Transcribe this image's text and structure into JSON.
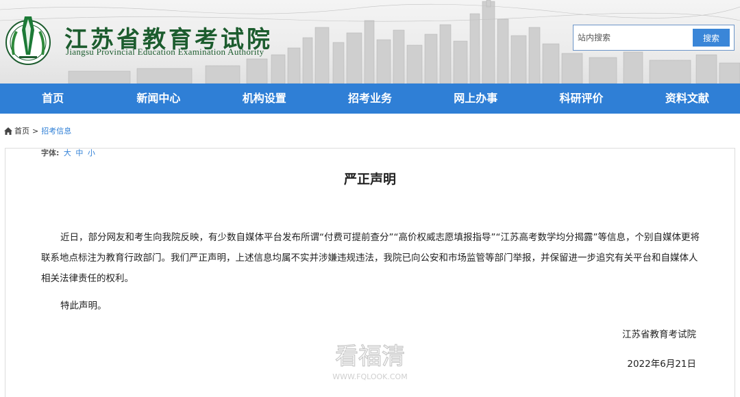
{
  "header": {
    "org_name_cn": "江苏省教育考试院",
    "org_name_en": "Jiangsu Provincial Education Examination Authority",
    "logo_icon": "provincial-emblem-icon"
  },
  "search": {
    "placeholder": "站内搜索",
    "button_label": "搜索"
  },
  "nav": {
    "items": [
      {
        "label": "首页"
      },
      {
        "label": "新闻中心"
      },
      {
        "label": "机构设置"
      },
      {
        "label": "招考业务"
      },
      {
        "label": "网上办事"
      },
      {
        "label": "科研评价"
      },
      {
        "label": "资料文献"
      }
    ]
  },
  "breadcrumb": {
    "icon": "home-icon",
    "home": "首页",
    "separator": ">",
    "current": "招考信息"
  },
  "article": {
    "fontsize_label": "字体:",
    "fontsize_options": [
      "大",
      "中",
      "小"
    ],
    "title": "严正声明",
    "paragraph1": "近日，部分网友和考生向我院反映，有少数自媒体平台发布所谓“付费可提前查分”“高价权威志愿填报指导”“江苏高考数学均分揭露”等信息，个别自媒体更将联系地点标注为教育行政部门。我们严正声明，上述信息均属不实并涉嫌违规违法，我院已向公安和市场监管等部门举报，并保留进一步追究有关平台和自媒体人相关法律责任的权利。",
    "paragraph2": "特此声明。",
    "signer": "江苏省教育考试院",
    "date": "2022年6月21日"
  },
  "watermark": {
    "text_cn": "看福清",
    "text_en": "WWW.FQLOOK.COM"
  },
  "colors": {
    "nav_bg": "#2f7fd6",
    "brand_green": "#1c5c2e",
    "link_blue": "#2f7fd6",
    "search_button": "#3a86d8"
  }
}
